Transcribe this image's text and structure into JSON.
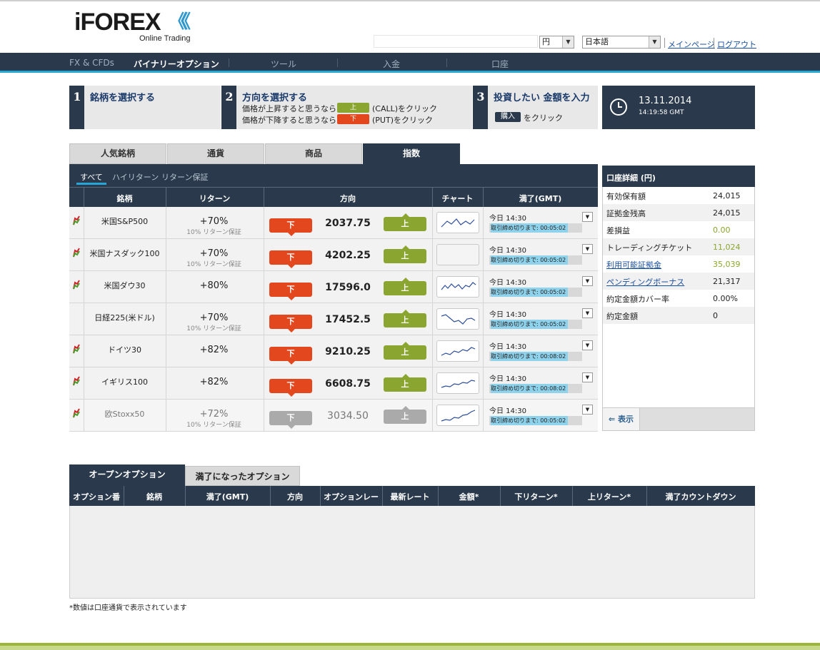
{
  "brand": {
    "name": "iFOREX",
    "chevrons": "《《",
    "tagline": "Online Trading"
  },
  "header": {
    "currency_select": "円",
    "language_select": "日本語",
    "main_page_link": "メインページ",
    "logout_link": "ログアウト"
  },
  "nav": {
    "items": [
      "FX & CFDs",
      "バイナリーオプション",
      "ツール",
      "入金",
      "口座"
    ],
    "active": "バイナリーオプション"
  },
  "steps": [
    {
      "num": "1",
      "title": "銘柄を選択する"
    },
    {
      "num": "2",
      "title": "方向を選択する",
      "line1_pre": "価格が上昇すると思うなら",
      "line1_btn": "上",
      "line1_post": "(CALL)をクリック",
      "line2_pre": "価格が下降すると思うなら",
      "line2_btn": "下",
      "line2_post": "(PUT)をクリック"
    },
    {
      "num": "3",
      "title": "投資したい 金額を入力",
      "btn": "購入",
      "post": "をクリック"
    }
  ],
  "clock": {
    "date": "13.11.2014",
    "time": "14:19:58 GMT"
  },
  "category_tabs": [
    "人気銘柄",
    "通貨",
    "商品",
    "指数"
  ],
  "sub_tabs": [
    "すべて",
    "ハイリターン",
    "リターン保証"
  ],
  "table_headers": [
    "銘柄",
    "リターン",
    "方向",
    "チャート",
    "満了(GMT)"
  ],
  "buttons": {
    "put": "下",
    "call": "上"
  },
  "rows": [
    {
      "name": "米国S&P500",
      "ret": "+70%",
      "guar": "10% リターン保証",
      "price": "2037.75",
      "exp": "今日 14:30",
      "cd": "取引締め切りまで: 00:05:02"
    },
    {
      "name": "米国ナスダック100",
      "ret": "+70%",
      "guar": "10% リターン保証",
      "price": "4202.25",
      "exp": "今日 14:30",
      "cd": "取引締め切りまで: 00:05:02"
    },
    {
      "name": "米国ダウ30",
      "ret": "+80%",
      "guar": "",
      "price": "17596.0",
      "exp": "今日 14:30",
      "cd": "取引締め切りまで: 00:05:02"
    },
    {
      "name": "日経225(米ドル)",
      "ret": "+70%",
      "guar": "10% リターン保証",
      "price": "17452.5",
      "exp": "今日 14:30",
      "cd": "取引締め切りまで: 00:05:02"
    },
    {
      "name": "ドイツ30",
      "ret": "+82%",
      "guar": "",
      "price": "9210.25",
      "exp": "今日 14:30",
      "cd": "取引締め切りまで: 00:08:02"
    },
    {
      "name": "イギリス100",
      "ret": "+82%",
      "guar": "",
      "price": "6608.75",
      "exp": "今日 14:30",
      "cd": "取引締め切りまで: 00:08:02"
    },
    {
      "name": "欧Stoxx50",
      "ret": "+72%",
      "guar": "10% リターン保証",
      "price": "3034.50",
      "exp": "今日 14:30",
      "cd": "取引締め切りまで: 00:05:02"
    }
  ],
  "account": {
    "title": "口座詳細 (円)",
    "items": [
      {
        "label": "有効保有額",
        "value": "24,015",
        "color": "#222222"
      },
      {
        "label": "証拠金残高",
        "value": "24,015",
        "color": "#222222"
      },
      {
        "label": "差損益",
        "value": "0.00",
        "color": "#8aa630"
      },
      {
        "label": "トレーディングチケット",
        "value": "11,024",
        "color": "#8aa630"
      },
      {
        "label": "利用可能証拠金",
        "value": "35,039",
        "color": "#8aa630"
      },
      {
        "label": "ペンディングボーナス",
        "value": "21,317",
        "color": "#222222"
      },
      {
        "label": "約定金額カバー率",
        "value": "0.00%",
        "color": "#222222"
      },
      {
        "label": "約定金額",
        "value": "0",
        "color": "#222222"
      }
    ],
    "show_button": "表示"
  },
  "bottom_tabs": [
    "オープンオプション",
    "満了になったオプション"
  ],
  "bottom_headers": [
    "オプション番",
    "銘柄",
    "満了(GMT)",
    "方向",
    "オプションレー",
    "最新レート",
    "金額*",
    "下リターン*",
    "上リターン*",
    "満了カウントダウン"
  ],
  "note": "*数値は口座通貨で表示されています",
  "colors": {
    "navy": "#2a3a4c",
    "put": "#e2471e",
    "call": "#8aa630",
    "accent": "#27a7d8"
  }
}
